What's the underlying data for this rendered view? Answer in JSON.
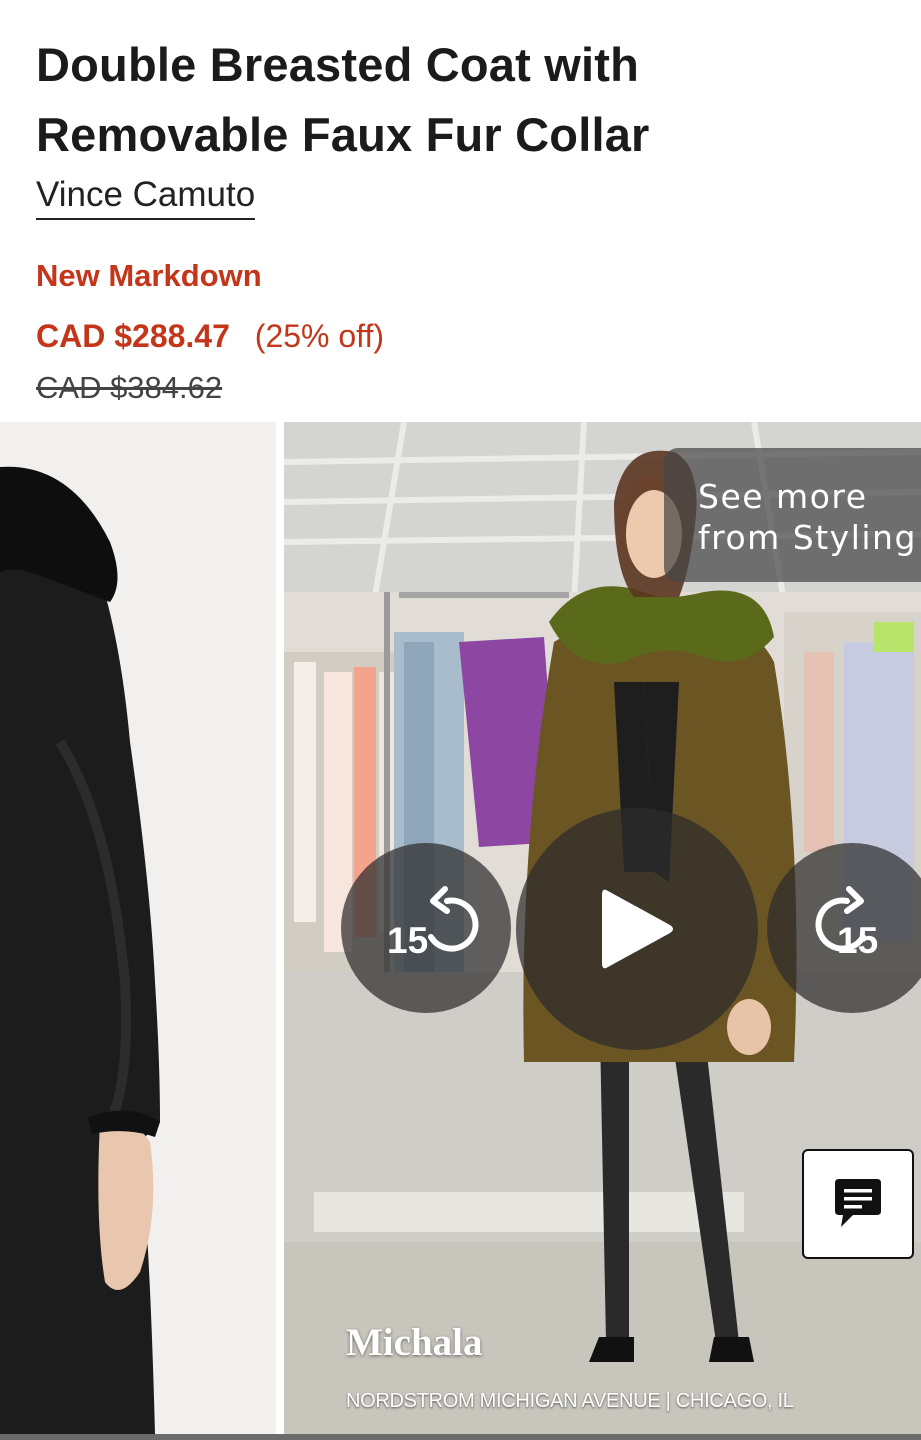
{
  "product": {
    "title": "Double Breasted Coat with Removable Faux Fur Collar",
    "brand": "Vince Camuto",
    "badge": "New Markdown",
    "sale_price": "CAD $288.47",
    "discount": "(25% off)",
    "original_price": "CAD $384.62"
  },
  "video": {
    "see_more": "See more\nfrom Styling",
    "rewind_seconds": "15",
    "forward_seconds": "15",
    "stylist_name": "Michala",
    "location": "NORDSTROM MICHIGAN AVENUE | CHICAGO, IL"
  },
  "icons": {
    "rewind": "rewind-icon",
    "play": "play-icon",
    "forward": "forward-icon",
    "chat": "chat-icon"
  },
  "colors": {
    "sale": "#c3361a",
    "text": "#1b1b1b",
    "coat_left": "#1a1a1a",
    "coat_video": "#6b5523",
    "fur_collar": "#5a6a1a"
  }
}
